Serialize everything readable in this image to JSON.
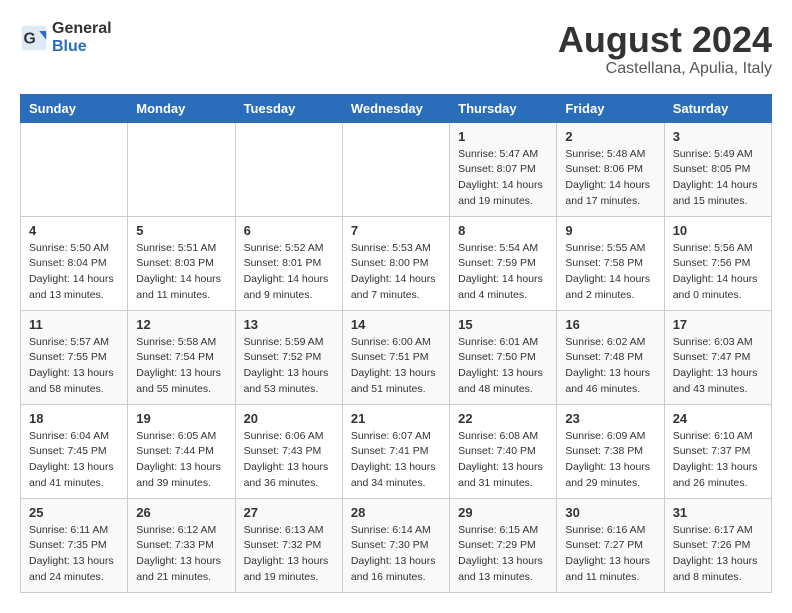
{
  "logo": {
    "general": "General",
    "blue": "Blue"
  },
  "title": "August 2024",
  "subtitle": "Castellana, Apulia, Italy",
  "days_header": [
    "Sunday",
    "Monday",
    "Tuesday",
    "Wednesday",
    "Thursday",
    "Friday",
    "Saturday"
  ],
  "weeks": [
    [
      {
        "day": "",
        "sunrise": "",
        "sunset": "",
        "daylight": ""
      },
      {
        "day": "",
        "sunrise": "",
        "sunset": "",
        "daylight": ""
      },
      {
        "day": "",
        "sunrise": "",
        "sunset": "",
        "daylight": ""
      },
      {
        "day": "",
        "sunrise": "",
        "sunset": "",
        "daylight": ""
      },
      {
        "day": "1",
        "sunrise": "Sunrise: 5:47 AM",
        "sunset": "Sunset: 8:07 PM",
        "daylight": "Daylight: 14 hours and 19 minutes."
      },
      {
        "day": "2",
        "sunrise": "Sunrise: 5:48 AM",
        "sunset": "Sunset: 8:06 PM",
        "daylight": "Daylight: 14 hours and 17 minutes."
      },
      {
        "day": "3",
        "sunrise": "Sunrise: 5:49 AM",
        "sunset": "Sunset: 8:05 PM",
        "daylight": "Daylight: 14 hours and 15 minutes."
      }
    ],
    [
      {
        "day": "4",
        "sunrise": "Sunrise: 5:50 AM",
        "sunset": "Sunset: 8:04 PM",
        "daylight": "Daylight: 14 hours and 13 minutes."
      },
      {
        "day": "5",
        "sunrise": "Sunrise: 5:51 AM",
        "sunset": "Sunset: 8:03 PM",
        "daylight": "Daylight: 14 hours and 11 minutes."
      },
      {
        "day": "6",
        "sunrise": "Sunrise: 5:52 AM",
        "sunset": "Sunset: 8:01 PM",
        "daylight": "Daylight: 14 hours and 9 minutes."
      },
      {
        "day": "7",
        "sunrise": "Sunrise: 5:53 AM",
        "sunset": "Sunset: 8:00 PM",
        "daylight": "Daylight: 14 hours and 7 minutes."
      },
      {
        "day": "8",
        "sunrise": "Sunrise: 5:54 AM",
        "sunset": "Sunset: 7:59 PM",
        "daylight": "Daylight: 14 hours and 4 minutes."
      },
      {
        "day": "9",
        "sunrise": "Sunrise: 5:55 AM",
        "sunset": "Sunset: 7:58 PM",
        "daylight": "Daylight: 14 hours and 2 minutes."
      },
      {
        "day": "10",
        "sunrise": "Sunrise: 5:56 AM",
        "sunset": "Sunset: 7:56 PM",
        "daylight": "Daylight: 14 hours and 0 minutes."
      }
    ],
    [
      {
        "day": "11",
        "sunrise": "Sunrise: 5:57 AM",
        "sunset": "Sunset: 7:55 PM",
        "daylight": "Daylight: 13 hours and 58 minutes."
      },
      {
        "day": "12",
        "sunrise": "Sunrise: 5:58 AM",
        "sunset": "Sunset: 7:54 PM",
        "daylight": "Daylight: 13 hours and 55 minutes."
      },
      {
        "day": "13",
        "sunrise": "Sunrise: 5:59 AM",
        "sunset": "Sunset: 7:52 PM",
        "daylight": "Daylight: 13 hours and 53 minutes."
      },
      {
        "day": "14",
        "sunrise": "Sunrise: 6:00 AM",
        "sunset": "Sunset: 7:51 PM",
        "daylight": "Daylight: 13 hours and 51 minutes."
      },
      {
        "day": "15",
        "sunrise": "Sunrise: 6:01 AM",
        "sunset": "Sunset: 7:50 PM",
        "daylight": "Daylight: 13 hours and 48 minutes."
      },
      {
        "day": "16",
        "sunrise": "Sunrise: 6:02 AM",
        "sunset": "Sunset: 7:48 PM",
        "daylight": "Daylight: 13 hours and 46 minutes."
      },
      {
        "day": "17",
        "sunrise": "Sunrise: 6:03 AM",
        "sunset": "Sunset: 7:47 PM",
        "daylight": "Daylight: 13 hours and 43 minutes."
      }
    ],
    [
      {
        "day": "18",
        "sunrise": "Sunrise: 6:04 AM",
        "sunset": "Sunset: 7:45 PM",
        "daylight": "Daylight: 13 hours and 41 minutes."
      },
      {
        "day": "19",
        "sunrise": "Sunrise: 6:05 AM",
        "sunset": "Sunset: 7:44 PM",
        "daylight": "Daylight: 13 hours and 39 minutes."
      },
      {
        "day": "20",
        "sunrise": "Sunrise: 6:06 AM",
        "sunset": "Sunset: 7:43 PM",
        "daylight": "Daylight: 13 hours and 36 minutes."
      },
      {
        "day": "21",
        "sunrise": "Sunrise: 6:07 AM",
        "sunset": "Sunset: 7:41 PM",
        "daylight": "Daylight: 13 hours and 34 minutes."
      },
      {
        "day": "22",
        "sunrise": "Sunrise: 6:08 AM",
        "sunset": "Sunset: 7:40 PM",
        "daylight": "Daylight: 13 hours and 31 minutes."
      },
      {
        "day": "23",
        "sunrise": "Sunrise: 6:09 AM",
        "sunset": "Sunset: 7:38 PM",
        "daylight": "Daylight: 13 hours and 29 minutes."
      },
      {
        "day": "24",
        "sunrise": "Sunrise: 6:10 AM",
        "sunset": "Sunset: 7:37 PM",
        "daylight": "Daylight: 13 hours and 26 minutes."
      }
    ],
    [
      {
        "day": "25",
        "sunrise": "Sunrise: 6:11 AM",
        "sunset": "Sunset: 7:35 PM",
        "daylight": "Daylight: 13 hours and 24 minutes."
      },
      {
        "day": "26",
        "sunrise": "Sunrise: 6:12 AM",
        "sunset": "Sunset: 7:33 PM",
        "daylight": "Daylight: 13 hours and 21 minutes."
      },
      {
        "day": "27",
        "sunrise": "Sunrise: 6:13 AM",
        "sunset": "Sunset: 7:32 PM",
        "daylight": "Daylight: 13 hours and 19 minutes."
      },
      {
        "day": "28",
        "sunrise": "Sunrise: 6:14 AM",
        "sunset": "Sunset: 7:30 PM",
        "daylight": "Daylight: 13 hours and 16 minutes."
      },
      {
        "day": "29",
        "sunrise": "Sunrise: 6:15 AM",
        "sunset": "Sunset: 7:29 PM",
        "daylight": "Daylight: 13 hours and 13 minutes."
      },
      {
        "day": "30",
        "sunrise": "Sunrise: 6:16 AM",
        "sunset": "Sunset: 7:27 PM",
        "daylight": "Daylight: 13 hours and 11 minutes."
      },
      {
        "day": "31",
        "sunrise": "Sunrise: 6:17 AM",
        "sunset": "Sunset: 7:26 PM",
        "daylight": "Daylight: 13 hours and 8 minutes."
      }
    ]
  ]
}
